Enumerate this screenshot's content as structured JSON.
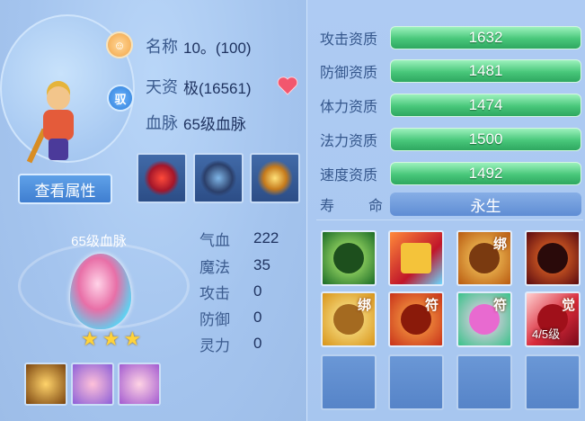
{
  "pet": {
    "name_label": "名称",
    "name_value": "10。(100)",
    "aptitude_label": "天资",
    "aptitude_value": "极(16561)",
    "bloodline_label": "血脉",
    "bloodline_value": "65级血脉",
    "tame_badge": "驭"
  },
  "buttons": {
    "view_attributes": "查看属性"
  },
  "bloodline_panel": {
    "title": "65级血脉",
    "star_count": 3,
    "stars": [
      "★",
      "★",
      "★"
    ]
  },
  "stats": [
    {
      "label": "气血",
      "value": "222"
    },
    {
      "label": "魔法",
      "value": "35"
    },
    {
      "label": "攻击",
      "value": "0"
    },
    {
      "label": "防御",
      "value": "0"
    },
    {
      "label": "灵力",
      "value": "0"
    }
  ],
  "aptitudes": [
    {
      "label": "攻击资质",
      "value": "1632"
    },
    {
      "label": "防御资质",
      "value": "1481"
    },
    {
      "label": "体力资质",
      "value": "1474"
    },
    {
      "label": "法力资质",
      "value": "1500"
    },
    {
      "label": "速度资质",
      "value": "1492"
    }
  ],
  "lifespan": {
    "label_1": "寿",
    "label_2": "命",
    "value": "永生"
  },
  "skills": [
    {
      "icon": "green-warrior-skill-icon",
      "tag": "",
      "level": ""
    },
    {
      "icon": "red-card-lightning-skill-icon",
      "tag": "",
      "level": ""
    },
    {
      "icon": "fist-skill-icon",
      "tag": "绑",
      "level": ""
    },
    {
      "icon": "demon-skill-icon",
      "tag": "",
      "level": ""
    },
    {
      "icon": "golden-shield-skill-icon",
      "tag": "绑",
      "level": ""
    },
    {
      "icon": "red-giant-skill-icon",
      "tag": "符",
      "level": ""
    },
    {
      "icon": "heart-skill-icon",
      "tag": "符",
      "level": ""
    },
    {
      "icon": "red-slash-skill-icon",
      "tag": "觉",
      "level": "4/5级"
    }
  ],
  "colors": {
    "aptitude_bar": "#48c77a",
    "accent_button": "#3f7ed0",
    "star": "#ffd33a"
  }
}
